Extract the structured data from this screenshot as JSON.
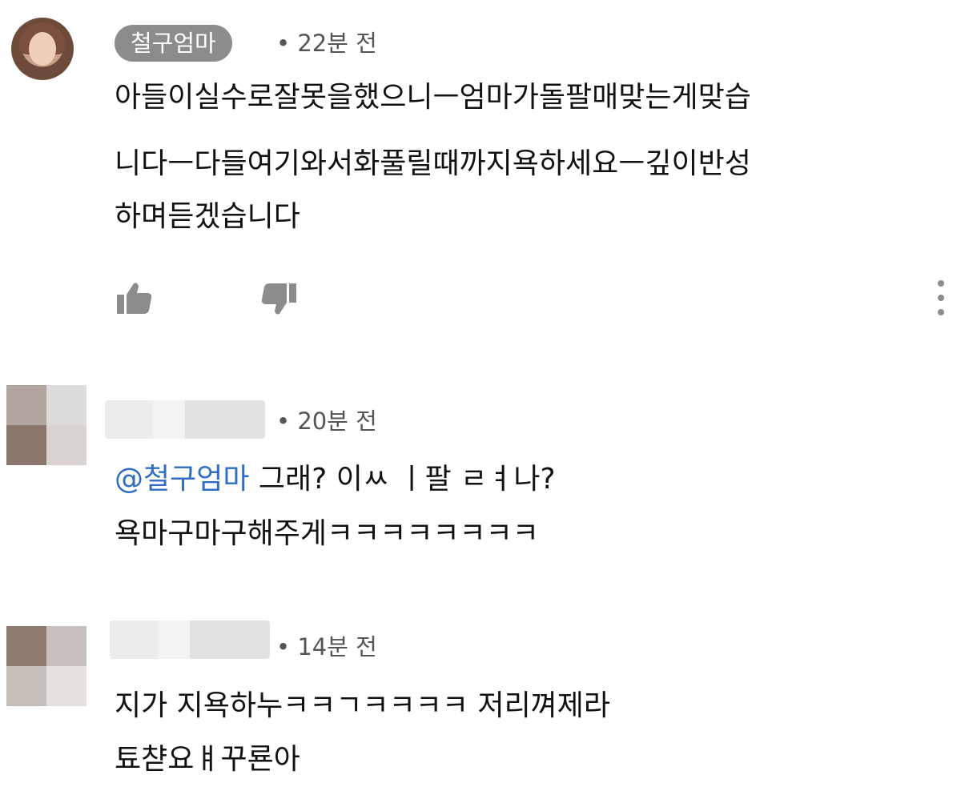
{
  "comments": [
    {
      "author": "철구엄마",
      "time": "• 22분 전",
      "lines": [
        "아들이실수로잘못을했으니ㅡ엄마가돌팔매맞는게맞습",
        "니다ㅡ다들여기와서화풀릴때까지욕하세요ㅡ깊이반성",
        "하며듣겠습니다"
      ]
    },
    {
      "time": "• 20분 전",
      "mention": "@철구엄마",
      "line1_rest": " 그래? 이ㅆ ㅣ팔 ㄹㅕ나?",
      "line2": "욕마구마구해주게ㅋㅋㅋㅋㅋㅋㅋㅋ"
    },
    {
      "time": "• 14분 전",
      "line1": "지가 지욕하누ㅋㅋㄱㅋㅋㅋㅋ 저리껴제라",
      "line2": "툐챧요ㅒ꾸룐아"
    }
  ],
  "icons": [
    "thumbs-up-icon",
    "thumbs-down-icon",
    "more-options-icon"
  ]
}
